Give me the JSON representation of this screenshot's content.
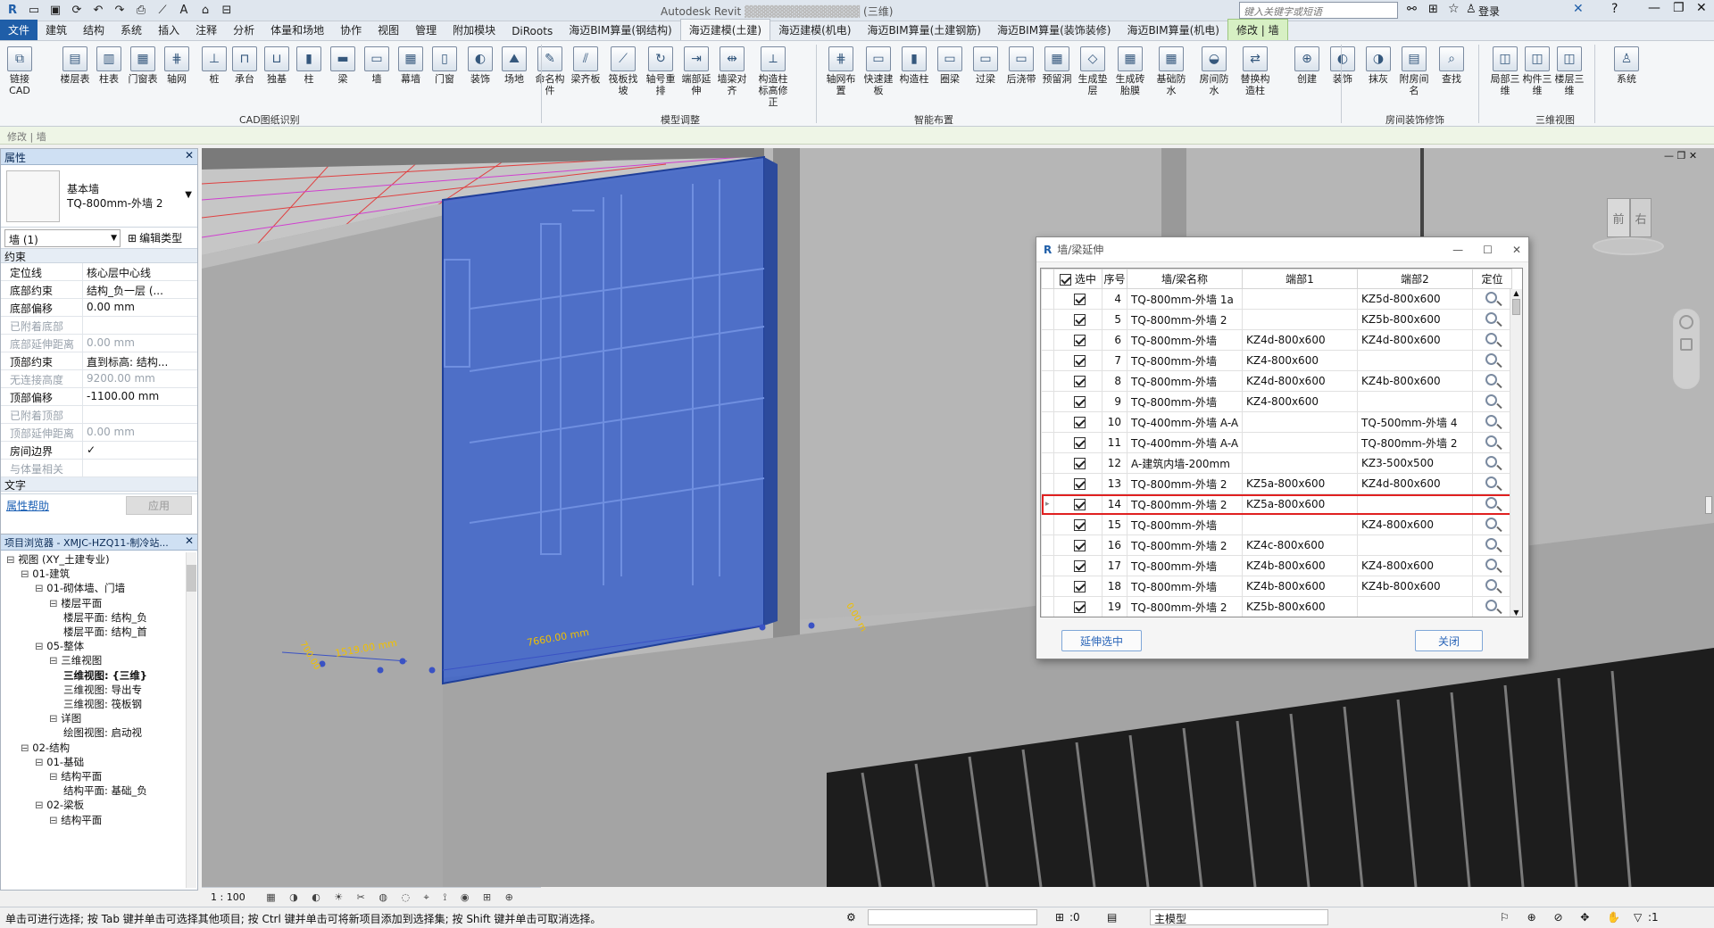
{
  "app": {
    "title": "Autodesk Revit",
    "view_suffix": "(三维)",
    "search_placeholder": "键入关键字或短语",
    "user": "登录"
  },
  "menu": {
    "tabs": [
      "文件",
      "建筑",
      "结构",
      "系统",
      "插入",
      "注释",
      "分析",
      "体量和场地",
      "协作",
      "视图",
      "管理",
      "附加模块",
      "DiRoots",
      "海迈BIM算量(钢结构)",
      "海迈建模(土建)",
      "海迈建模(机电)",
      "海迈BIM算量(土建钢筋)",
      "海迈BIM算量(装饰装修)",
      "海迈BIM算量(机电)",
      "修改 | 墙"
    ],
    "active_index": 14
  },
  "ribbon": {
    "buttons": [
      "链接CAD",
      "楼层表",
      "柱表",
      "门窗表",
      "轴网",
      "桩",
      "承台",
      "独基",
      "柱",
      "梁",
      "墙",
      "幕墙",
      "门窗",
      "装饰",
      "场地",
      "命名构件",
      "梁齐板",
      "筏板找坡",
      "轴号重排",
      "端部延伸",
      "墙梁对齐",
      "构造柱标高修正",
      "轴网布置",
      "快速建板",
      "构造柱",
      "圈梁",
      "过梁",
      "后浇带",
      "预留洞",
      "生成垫层",
      "生成砖胎膜",
      "基础防水",
      "房间防水",
      "替换构造柱",
      "创建",
      "装饰",
      "抹灰",
      "附房间名",
      "查找",
      "局部三维",
      "构件三维",
      "楼层三维",
      "系统"
    ],
    "groups": [
      "CAD图纸识别",
      "模型调整",
      "智能布置",
      "房间装饰修饰",
      "三维视图"
    ]
  },
  "optbar": {
    "text": "修改 | 墙"
  },
  "properties": {
    "title": "属性",
    "family": "基本墙",
    "type": "TQ-800mm-外墙 2",
    "selector": "墙 (1)",
    "edit_type": "编辑类型",
    "group_constraint": "约束",
    "rows": [
      {
        "k": "定位线",
        "v": "核心层中心线",
        "dim": false
      },
      {
        "k": "底部约束",
        "v": "结构_负一层 (...",
        "dim": false
      },
      {
        "k": "底部偏移",
        "v": "0.00 mm",
        "dim": false
      },
      {
        "k": "已附着底部",
        "v": "",
        "dim": true
      },
      {
        "k": "底部延伸距离",
        "v": "0.00 mm",
        "dim": true
      },
      {
        "k": "顶部约束",
        "v": "直到标高: 结构...",
        "dim": false
      },
      {
        "k": "无连接高度",
        "v": "9200.00 mm",
        "dim": true
      },
      {
        "k": "顶部偏移",
        "v": "-1100.00 mm",
        "dim": false
      },
      {
        "k": "已附着顶部",
        "v": "",
        "dim": true
      },
      {
        "k": "顶部延伸距离",
        "v": "0.00 mm",
        "dim": true
      },
      {
        "k": "房间边界",
        "v": "✓",
        "dim": false
      },
      {
        "k": "与体量相关",
        "v": "",
        "dim": true
      }
    ],
    "group_text": "文字",
    "help": "属性帮助",
    "apply": "应用"
  },
  "browser": {
    "title": "项目浏览器 - XMJC-HZQ11-制冷站...",
    "nodes": [
      {
        "t": "视图 (XY_土建专业)",
        "lvl": 0
      },
      {
        "t": "01-建筑",
        "lvl": 1
      },
      {
        "t": "01-砌体墙、门墙",
        "lvl": 2
      },
      {
        "t": "楼层平面",
        "lvl": 3
      },
      {
        "t": "楼层平面: 结构_负",
        "lvl": 4
      },
      {
        "t": "楼层平面: 结构_首",
        "lvl": 4
      },
      {
        "t": "05-整体",
        "lvl": 2
      },
      {
        "t": "三维视图",
        "lvl": 3
      },
      {
        "t": "三维视图: {三维}",
        "lvl": 4
      },
      {
        "t": "三维视图: 导出专",
        "lvl": 4
      },
      {
        "t": "三维视图: 筏板钢",
        "lvl": 4
      },
      {
        "t": "详图",
        "lvl": 3
      },
      {
        "t": "绘图视图: 启动视",
        "lvl": 4
      },
      {
        "t": "02-结构",
        "lvl": 1
      },
      {
        "t": "01-基础",
        "lvl": 2
      },
      {
        "t": "结构平面",
        "lvl": 3
      },
      {
        "t": "结构平面: 基础_负",
        "lvl": 4
      },
      {
        "t": "02-梁板",
        "lvl": 2
      },
      {
        "t": "结构平面",
        "lvl": 3
      }
    ]
  },
  "viewport": {
    "dim1": "7660.00 mm",
    "dim2": "1519.00 mm",
    "dim3": "700.00",
    "dim4": "0.00 m",
    "cube_front": "前",
    "cube_right": "右"
  },
  "viewbar": {
    "scale": "1 : 100"
  },
  "dialog": {
    "title": "墙/梁延伸",
    "headers": [
      "选中",
      "序号",
      "墙/梁名称",
      "端部1",
      "端部2",
      "定位"
    ],
    "rows": [
      {
        "n": "4",
        "name": "TQ-800mm-外墙 1a",
        "e1": "",
        "e2": "KZ5d-800x600"
      },
      {
        "n": "5",
        "name": "TQ-800mm-外墙 2",
        "e1": "",
        "e2": "KZ5b-800x600"
      },
      {
        "n": "6",
        "name": "TQ-800mm-外墙",
        "e1": "KZ4d-800x600",
        "e2": "KZ4d-800x600"
      },
      {
        "n": "7",
        "name": "TQ-800mm-外墙",
        "e1": "KZ4-800x600",
        "e2": ""
      },
      {
        "n": "8",
        "name": "TQ-800mm-外墙",
        "e1": "KZ4d-800x600",
        "e2": "KZ4b-800x600"
      },
      {
        "n": "9",
        "name": "TQ-800mm-外墙",
        "e1": "KZ4-800x600",
        "e2": ""
      },
      {
        "n": "10",
        "name": "TQ-400mm-外墙 A-A",
        "e1": "",
        "e2": "TQ-500mm-外墙 4"
      },
      {
        "n": "11",
        "name": "TQ-400mm-外墙 A-A",
        "e1": "",
        "e2": "TQ-800mm-外墙 2"
      },
      {
        "n": "12",
        "name": "A-建筑内墙-200mm",
        "e1": "",
        "e2": "KZ3-500x500"
      },
      {
        "n": "13",
        "name": "TQ-800mm-外墙 2",
        "e1": "KZ5a-800x600",
        "e2": "KZ4d-800x600"
      },
      {
        "n": "14",
        "name": "TQ-800mm-外墙 2",
        "e1": "KZ5a-800x600",
        "e2": ""
      },
      {
        "n": "15",
        "name": "TQ-800mm-外墙",
        "e1": "",
        "e2": "KZ4-800x600"
      },
      {
        "n": "16",
        "name": "TQ-800mm-外墙 2",
        "e1": "KZ4c-800x600",
        "e2": ""
      },
      {
        "n": "17",
        "name": "TQ-800mm-外墙",
        "e1": "KZ4b-800x600",
        "e2": "KZ4-800x600"
      },
      {
        "n": "18",
        "name": "TQ-800mm-外墙",
        "e1": "KZ4b-800x600",
        "e2": "KZ4b-800x600"
      },
      {
        "n": "19",
        "name": "TQ-800mm-外墙 2",
        "e1": "KZ5b-800x600",
        "e2": ""
      }
    ],
    "highlight_row": "14",
    "extend_btn": "延伸选中",
    "close_btn": "关闭"
  },
  "status": {
    "hint": "单击可进行选择; 按 Tab 键并单击可选择其他项目; 按 Ctrl 键并单击可将新项目添加到选择集; 按 Shift 键并单击可取消选择。",
    "sel_count": ":0",
    "model": "主模型",
    "filter": ":1"
  },
  "colors": {
    "accent": "#1f5ea8",
    "selection": "#3f64c8",
    "highlight": "#e02020"
  }
}
